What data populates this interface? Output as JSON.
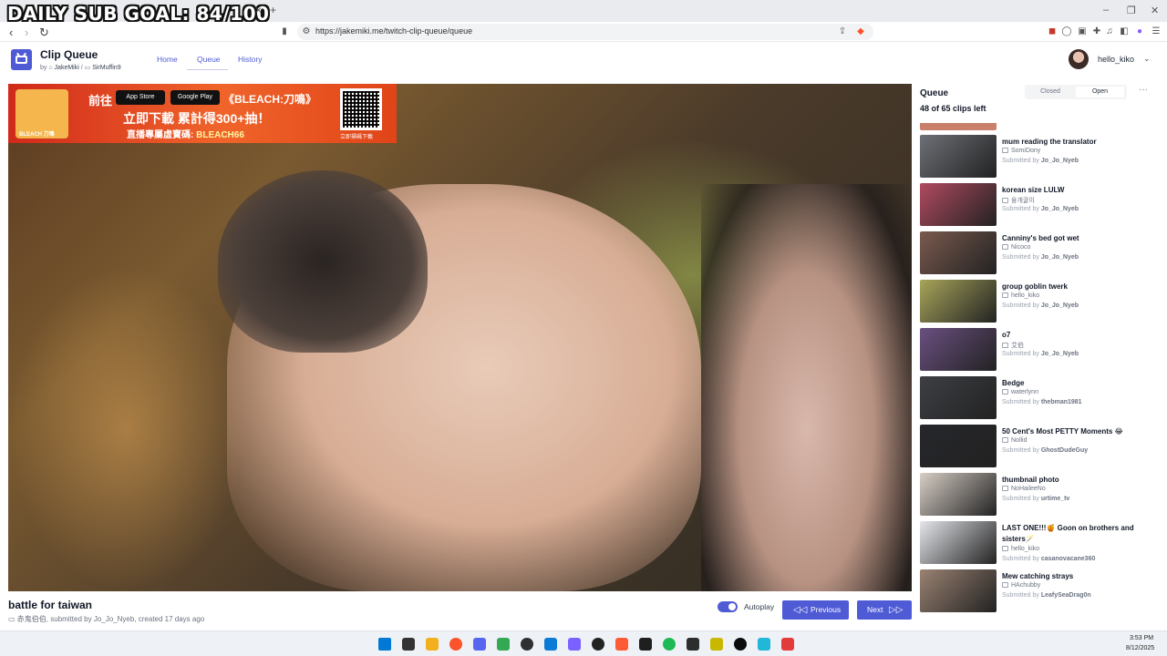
{
  "overlay": {
    "goal_text": "DAILY SUB GOAL: 84/100"
  },
  "browser": {
    "url": "https://jakemiki.me/twitch-clip-queue/queue",
    "tab_close": "×",
    "new_tab": "+",
    "window_controls": [
      "–",
      "❐",
      "✕"
    ],
    "nav": [
      "‹",
      "›",
      "↻"
    ]
  },
  "app": {
    "title": "Clip Queue",
    "by_prefix": "by",
    "author1": "JakeMiki",
    "author2": "SirMuffin9",
    "nav": [
      "Home",
      "Queue",
      "History"
    ],
    "user": "hello_kiko"
  },
  "ad": {
    "line1": "前往",
    "app_store": "App Store",
    "google_play": "Google Play",
    "brand": "《BLEACH:刀鳴》",
    "line2": "立即下載 累計得300+抽！",
    "line3_prefix": "直播專屬虛寶碼: ",
    "code": "BLEACH66",
    "qr_label": "立即掃碼下載",
    "char_label": "BLEACH 刀鳴"
  },
  "clip": {
    "title": "battle for taiwan",
    "channel": "赤鬼伯伯",
    "submitted_prefix": ", submitted by ",
    "submitter": "Jo_Jo_Nyeb",
    "created": ", created 17 days ago"
  },
  "controls": {
    "autoplay_label": "Autoplay",
    "previous_label": "Previous",
    "next_label": "Next"
  },
  "queue": {
    "title": "Queue",
    "count": "48 of 65 clips left",
    "closed": "Closed",
    "open": "Open",
    "more": "···",
    "submitted_prefix": "Submitted by ",
    "items": [
      {
        "title": "mum reading the translator",
        "channel": "SomiDony",
        "submitter": "Jo_Jo_Nyeb",
        "thumb": "#6d7076"
      },
      {
        "title": "korean size LULW",
        "channel": "융개굴이",
        "submitter": "Jo_Jo_Nyeb",
        "thumb": "#b04a60"
      },
      {
        "title": "Canniny's bed got wet",
        "channel": "Nicoco",
        "submitter": "Jo_Jo_Nyeb",
        "thumb": "#7a5a4e"
      },
      {
        "title": "group goblin twerk",
        "channel": "hello_kiko",
        "submitter": "Jo_Jo_Nyeb",
        "thumb": "#a8a55a"
      },
      {
        "title": "o7",
        "channel": "艾伯",
        "submitter": "Jo_Jo_Nyeb",
        "thumb": "#6a4f80"
      },
      {
        "title": "Bedge",
        "channel": "waterlynn",
        "submitter": "thebman1981",
        "thumb": "#3d3f44"
      },
      {
        "title": "50 Cent's Most PETTY Moments 😂",
        "channel": "Nollid",
        "submitter": "GhostDudeGuy",
        "thumb": "#26272b"
      },
      {
        "title": "thumbnail photo",
        "channel": "NoHaileeNo",
        "submitter": "urtime_tv",
        "thumb": "#d8cfc6"
      },
      {
        "title": "LAST ONE!!!🍯 Goon on brothers and sisters🪄",
        "channel": "hello_kiko",
        "submitter": "casanovacane360",
        "thumb": "#e4e6ea"
      },
      {
        "title": "Mew catching strays",
        "channel": "HAchubby",
        "submitter": "LeafySeaDrag0n",
        "thumb": "#9a8272"
      }
    ]
  },
  "taskbar": {
    "time": "3:53 PM",
    "date": "8/12/2025",
    "icons": [
      "windows-icon",
      "task-view-icon",
      "file-explorer-icon",
      "brave-icon",
      "discord-icon",
      "chrome-icon",
      "obs-icon",
      "edge-icon",
      "vpn-icon",
      "app-icon",
      "brave-beta-icon",
      "notepad-icon",
      "spotify-icon",
      "terminal-icon",
      "streamlabs-icon",
      "cmd-icon",
      "browser-icon",
      "game-icon"
    ],
    "colors": [
      "#0078d4",
      "#333333",
      "#f2b01e",
      "#fb542b",
      "#5865f2",
      "#34a853",
      "#302e31",
      "#0c7bd6",
      "#7b61ff",
      "#222222",
      "#ff5a36",
      "#1f1f1f",
      "#1db954",
      "#2d2d2d",
      "#c8b800",
      "#0c0c0c",
      "#20b7d8",
      "#e23b3b"
    ]
  },
  "colors": {
    "accent": "#4f5bd5",
    "ad_red": "#d02a1a"
  }
}
